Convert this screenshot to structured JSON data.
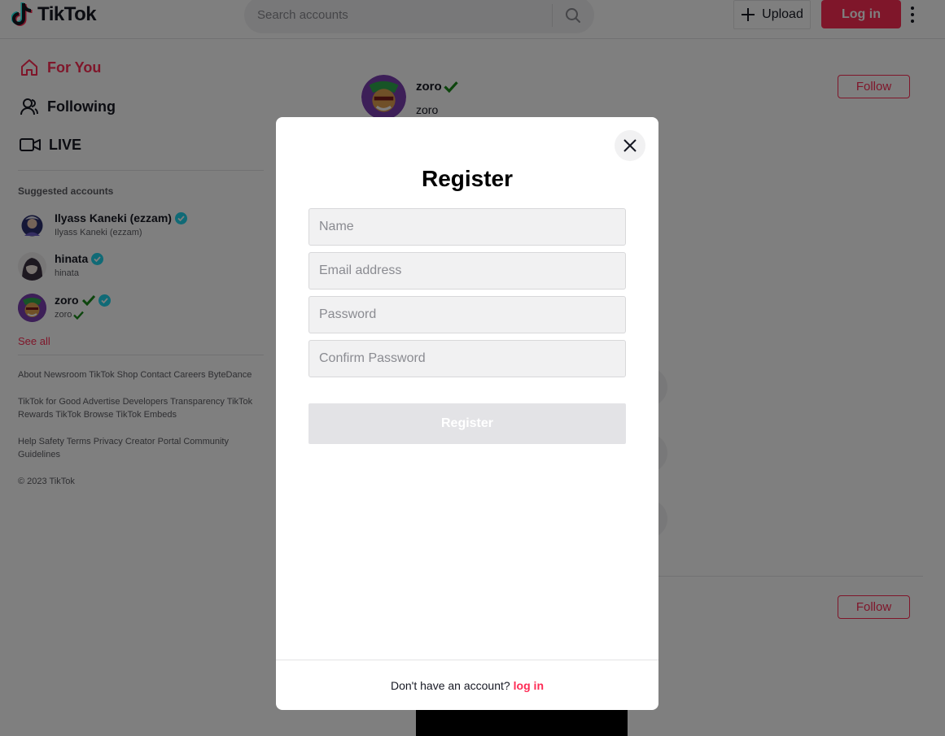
{
  "header": {
    "logo_text": "TikTok",
    "search_placeholder": "Search accounts",
    "upload_label": "Upload",
    "login_label": "Log in"
  },
  "sidebar": {
    "nav": [
      {
        "label": "For You",
        "icon": "home-icon",
        "active": true
      },
      {
        "label": "Following",
        "icon": "user-icon",
        "active": false
      },
      {
        "label": "LIVE",
        "icon": "video-camera-icon",
        "active": false
      }
    ],
    "suggested_heading": "Suggested accounts",
    "accounts": [
      {
        "name": "Ilyass Kaneki (ezzam)",
        "sub": "Ilyass Kaneki (ezzam)",
        "verified": true
      },
      {
        "name": "hinata",
        "sub": "hinata",
        "verified": true
      },
      {
        "name": "zoro",
        "sub": "zoro",
        "verified": true
      }
    ],
    "see_all": "See all",
    "footer": [
      "About Newsroom TikTok Shop Contact Careers ByteDance",
      "TikTok for Good Advertise Developers Transparency TikTok Rewards TikTok Browse TikTok Embeds",
      "Help Safety Terms Privacy Creator Portal Community Guidelines",
      "© 2023 TikTok"
    ]
  },
  "feed": {
    "post": {
      "name": "zoro",
      "sub": "zoro",
      "follow_label": "Follow"
    },
    "post2": {
      "follow_label": "Follow"
    }
  },
  "modal": {
    "title": "Register",
    "fields": {
      "name_placeholder": "Name",
      "email_placeholder": "Email address",
      "password_placeholder": "Password",
      "confirm_placeholder": "Confirm Password"
    },
    "submit_label": "Register",
    "footer_text": "Don't have an account?",
    "footer_link": "log in"
  },
  "colors": {
    "brand": "#fe2c55",
    "overlay": "rgba(0,0,0,0.5)",
    "verified": "#20d5ec",
    "checkmark": "#1a8a1a"
  }
}
